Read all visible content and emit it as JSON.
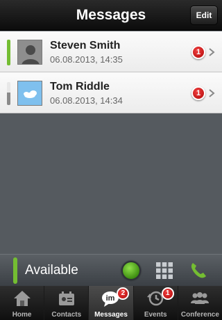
{
  "header": {
    "title": "Messages",
    "edit_label": "Edit"
  },
  "conversations": [
    {
      "name": "Steven Smith",
      "time": "06.08.2013, 14:35",
      "unread": "1"
    },
    {
      "name": "Tom Riddle",
      "time": "06.08.2013, 14:34",
      "unread": "1"
    }
  ],
  "status": {
    "label": "Available",
    "color": "#74bd32"
  },
  "tabs": [
    {
      "label": "Home",
      "icon": "home-icon"
    },
    {
      "label": "Contacts",
      "icon": "contacts-icon"
    },
    {
      "label": "Messages",
      "icon": "im-icon",
      "badge": "2",
      "active": true
    },
    {
      "label": "Events",
      "icon": "history-icon",
      "badge": "1"
    },
    {
      "label": "Conference",
      "icon": "conference-icon"
    }
  ],
  "icons": {
    "im_glyph": "im"
  },
  "colors": {
    "accent_green": "#74bd32",
    "badge_red": "#d01515"
  }
}
